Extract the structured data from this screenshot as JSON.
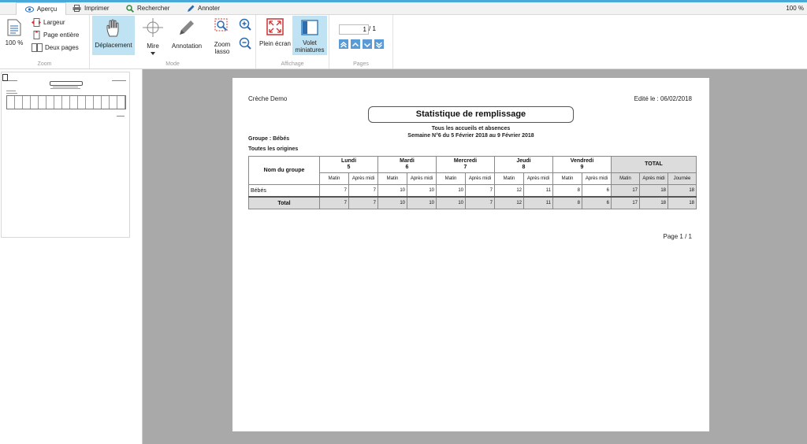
{
  "tabs": [
    {
      "label": "Aperçu",
      "icon": "eye-icon"
    },
    {
      "label": "Imprimer",
      "icon": "printer-icon"
    },
    {
      "label": "Rechercher",
      "icon": "search-icon"
    },
    {
      "label": "Annoter",
      "icon": "pencil-icon"
    }
  ],
  "zoom_right": "100 %",
  "ribbon": {
    "zoom": {
      "percent_label": "100 %",
      "largeur": "Largeur",
      "page_entiere": "Page entière",
      "deux_pages": "Deux pages",
      "group": "Zoom"
    },
    "mode": {
      "deplacement": "Déplacement",
      "mire": "Mire",
      "annotation": "Annotation",
      "zoom_lasso_1": "Zoom",
      "zoom_lasso_2": "lasso",
      "group": "Mode"
    },
    "affichage": {
      "plein_ecran": "Plein écran",
      "volet_1": "Volet",
      "volet_2": "miniatures",
      "group": "Affichage"
    },
    "pages": {
      "current": "1",
      "total": "/ 1",
      "group": "Pages"
    }
  },
  "report": {
    "org": "Crèche Demo",
    "edited": "Edité le : 06/02/2018",
    "title": "Statistique de remplissage",
    "subtitle1": "Tous les accueils et absences",
    "subtitle2": "Semaine N°6 du 5 Février 2018 au 9 Février 2018",
    "group_line": "Groupe : Bébés",
    "origin_line": "Toutes les origines",
    "col_group": "Nom du groupe",
    "days": [
      {
        "name": "Lundi",
        "num": "5"
      },
      {
        "name": "Mardi",
        "num": "6"
      },
      {
        "name": "Mercredi",
        "num": "7"
      },
      {
        "name": "Jeudi",
        "num": "8"
      },
      {
        "name": "Vendredi",
        "num": "9"
      }
    ],
    "total_header": "TOTAL",
    "matin": "Matin",
    "apres_midi": "Après midi",
    "journee": "Journée",
    "rows": [
      {
        "label": "Bébés",
        "values": [
          "7",
          "7",
          "10",
          "10",
          "10",
          "7",
          "12",
          "11",
          "8",
          "6"
        ],
        "totals": [
          "17",
          "18",
          "18"
        ]
      },
      {
        "label": "Total",
        "values": [
          "7",
          "7",
          "10",
          "10",
          "10",
          "7",
          "12",
          "11",
          "8",
          "6"
        ],
        "totals": [
          "17",
          "18",
          "18"
        ]
      }
    ],
    "page_footer": "Page 1 / 1"
  }
}
